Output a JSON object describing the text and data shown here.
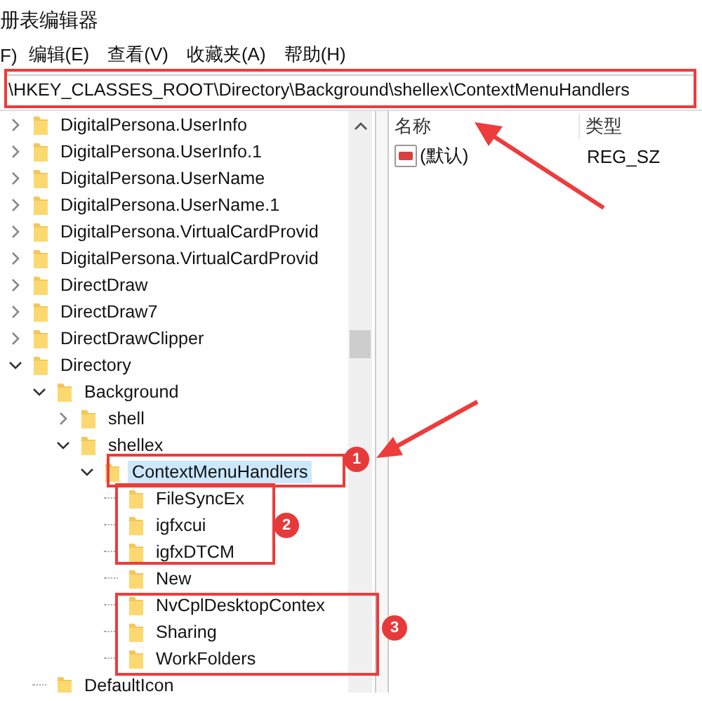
{
  "window": {
    "title": "册表编辑器"
  },
  "menu": [
    "F)",
    "编辑(E)",
    "查看(V)",
    "收藏夹(A)",
    "帮助(H)"
  ],
  "address": "\\HKEY_CLASSES_ROOT\\Directory\\Background\\shellex\\ContextMenuHandlers",
  "tree": [
    {
      "label": "DigitalPersona.UserInfo",
      "expanded": false,
      "selected": false
    },
    {
      "label": "DigitalPersona.UserInfo.1",
      "expanded": false,
      "selected": false
    },
    {
      "label": "DigitalPersona.UserName",
      "expanded": false,
      "selected": false
    },
    {
      "label": "DigitalPersona.UserName.1",
      "expanded": false,
      "selected": false
    },
    {
      "label": "DigitalPersona.VirtualCardProvid",
      "expanded": false,
      "selected": false
    },
    {
      "label": "DigitalPersona.VirtualCardProvid",
      "expanded": false,
      "selected": false
    },
    {
      "label": "DirectDraw",
      "expanded": false,
      "selected": false
    },
    {
      "label": "DirectDraw7",
      "expanded": false,
      "selected": false
    },
    {
      "label": "DirectDrawClipper",
      "expanded": false,
      "selected": false
    },
    {
      "label": "Directory",
      "expanded": true,
      "selected": false,
      "children": [
        {
          "label": "Background",
          "expanded": true,
          "selected": false,
          "children": [
            {
              "label": "shell",
              "expanded": false,
              "selected": false
            },
            {
              "label": "shellex",
              "expanded": true,
              "selected": false,
              "children": [
                {
                  "label": "ContextMenuHandlers",
                  "expanded": true,
                  "selected": true,
                  "children": [
                    {
                      "label": "FileSyncEx",
                      "selected": false
                    },
                    {
                      "label": "igfxcui",
                      "selected": false
                    },
                    {
                      "label": "igfxDTCM",
                      "selected": false
                    },
                    {
                      "label": "New",
                      "selected": false
                    },
                    {
                      "label": "NvCplDesktopContex",
                      "selected": false
                    },
                    {
                      "label": "Sharing",
                      "selected": false
                    },
                    {
                      "label": "WorkFolders",
                      "selected": false
                    }
                  ]
                }
              ]
            }
          ]
        },
        {
          "label": "DefaultIcon",
          "selected": false
        }
      ]
    }
  ],
  "values": {
    "columns": [
      "名称",
      "类型"
    ],
    "rows": [
      {
        "name": "(默认)",
        "type": "REG_SZ"
      }
    ]
  },
  "annotations": {
    "badges": [
      "1",
      "2",
      "3"
    ]
  }
}
